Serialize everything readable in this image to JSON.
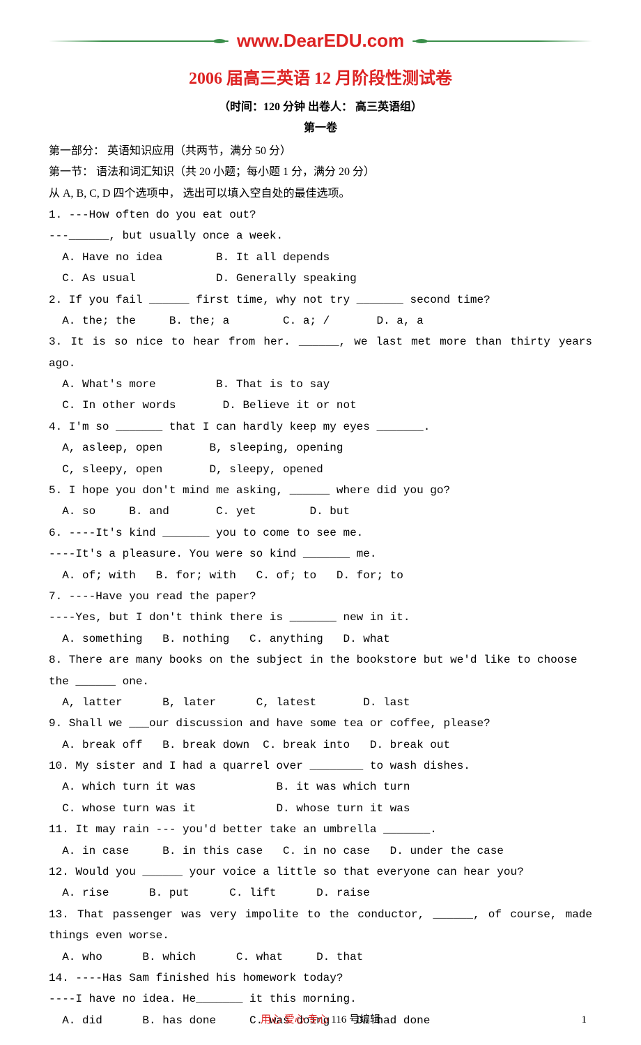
{
  "brand": "www.DearEDU.com",
  "title": "2006 届高三英语 12 月阶段性测试卷",
  "subtitle": "（时间：120 分钟  出卷人： 高三英语组）",
  "volume": "第一卷",
  "part": "第一部分： 英语知识应用（共两节，满分 50 分）",
  "sect": "第一节： 语法和词汇知识（共 20 小题；每小题 1 分，满分 20 分）",
  "instr": "从 A, B, C, D 四个选项中， 选出可以填入空自处的最佳选项。",
  "questions": [
    {
      "lines": [
        "1. ---How often do you eat out?",
        "  ---______, but usually once a week."
      ],
      "opts": [
        "  A. Have no idea        B. It all depends",
        "  C. As usual            D. Generally speaking"
      ]
    },
    {
      "lines": [
        "2. If you fail ______ first time, why not try _______ second time?"
      ],
      "opts": [
        "  A. the; the     B. the; a        C. a; /       D. a, a"
      ]
    },
    {
      "lines": [
        "3. It is so nice to hear from her. ______, we last met more than thirty years ago."
      ],
      "opts": [
        "  A. What's more         B. That is to say",
        "  C. In other words       D. Believe it or not"
      ]
    },
    {
      "lines": [
        "4. I'm so _______ that I can hardly keep my eyes _______."
      ],
      "opts": [
        "  A, asleep, open       B, sleeping, opening",
        "  C, sleepy, open       D, sleepy, opened"
      ]
    },
    {
      "lines": [
        "5. I hope you don't mind me asking, ______ where did you go?"
      ],
      "opts": [
        "  A. so     B. and       C. yet        D. but"
      ]
    },
    {
      "lines": [
        "6. ----It's kind _______ you to come to see me.",
        "  ----It's a pleasure. You were so kind _______ me."
      ],
      "opts": [
        "  A. of; with   B. for; with   C. of; to   D. for; to"
      ]
    },
    {
      "lines": [
        "7. ----Have you read the paper?",
        "  ----Yes, but I don't think there is _______ new in it."
      ],
      "opts": [
        "  A. something   B. nothing   C. anything   D. what"
      ]
    },
    {
      "lines": [
        "8. There are many books on the subject in the bookstore but we'd like to choose",
        "  the ______ one."
      ],
      "opts": [
        "  A, latter      B, later      C, latest       D. last"
      ]
    },
    {
      "lines": [
        "9. Shall we ___our discussion and have some tea or coffee, please?"
      ],
      "opts": [
        "  A. break off   B. break down  C. break into   D. break out"
      ]
    },
    {
      "lines": [
        "10. My sister and I had a quarrel over ________ to wash dishes."
      ],
      "opts": [
        "  A. which turn it was            B. it was which turn",
        "  C. whose turn was it            D. whose turn it was"
      ]
    },
    {
      "lines": [
        "11. It may rain --- you'd better take an umbrella _______."
      ],
      "opts": [
        "  A. in case     B. in this case   C. in no case   D. under the case"
      ]
    },
    {
      "lines": [
        "12. Would you ______ your voice a little so that everyone can hear you?"
      ],
      "opts": [
        "  A. rise      B. put      C. lift      D. raise"
      ]
    },
    {
      "lines": [
        "13. That passenger was very impolite to the conductor, ______, of course, made",
        "things even worse."
      ],
      "opts": [
        "  A. who      B. which      C. what     D. that"
      ],
      "justifyFirst": true
    },
    {
      "lines": [
        "14. ----Has Sam finished his homework today?",
        "  ----I have no idea. He_______ it this morning."
      ],
      "opts": [
        "  A. did      B. has done     C. was doing    D. had done"
      ]
    }
  ],
  "footer_love": "用心 爱心 专心",
  "footer_suffix": "  116 号编辑",
  "page_num": "1"
}
